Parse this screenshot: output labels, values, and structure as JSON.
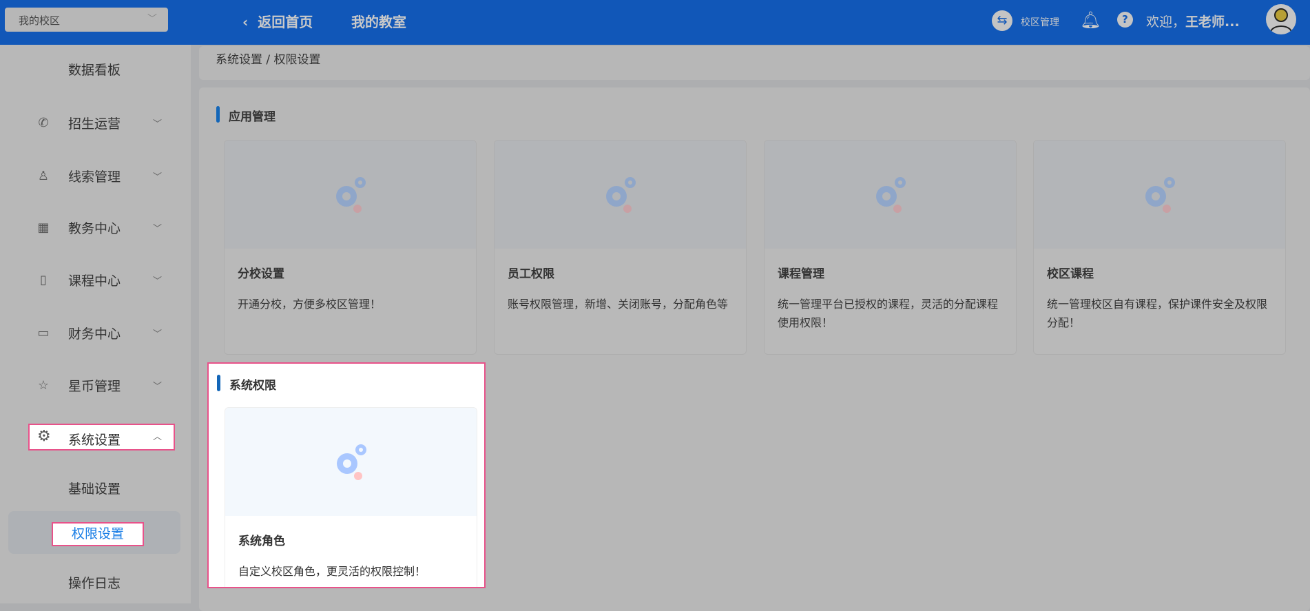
{
  "header": {
    "campus_select": "我的校区",
    "back_home": "返回首页",
    "my_classroom": "我的教室",
    "campus_manage": "校区管理",
    "welcome": "欢迎，",
    "user": "王老师..."
  },
  "breadcrumb": "系统设置 / 权限设置",
  "sidebar": {
    "items": [
      {
        "label": "数据看板",
        "icon": ""
      },
      {
        "label": "招生运营",
        "icon": "phone-icon"
      },
      {
        "label": "线索管理",
        "icon": "user-icon"
      },
      {
        "label": "教务中心",
        "icon": "building-icon"
      },
      {
        "label": "课程中心",
        "icon": "notebook-icon"
      },
      {
        "label": "财务中心",
        "icon": "card-icon"
      },
      {
        "label": "星币管理",
        "icon": "star-icon"
      },
      {
        "label": "系统设置",
        "icon": "gear-icon"
      }
    ],
    "sub_items": [
      "基础设置",
      "权限设置",
      "操作日志"
    ]
  },
  "sections": [
    {
      "title": "应用管理",
      "cards": [
        {
          "title": "分校设置",
          "desc": "开通分校，方便多校区管理！"
        },
        {
          "title": "员工权限",
          "desc": "账号权限管理，新增、关闭账号，分配角色等"
        },
        {
          "title": "课程管理",
          "desc": "统一管理平台已授权的课程，灵活的分配课程使用权限！"
        },
        {
          "title": "校区课程",
          "desc": "统一管理校区自有课程，保护课件安全及权限分配！"
        }
      ]
    },
    {
      "title": "系统权限",
      "cards": [
        {
          "title": "系统角色",
          "desc": "自定义校区角色，更灵活的权限控制！"
        }
      ]
    }
  ]
}
